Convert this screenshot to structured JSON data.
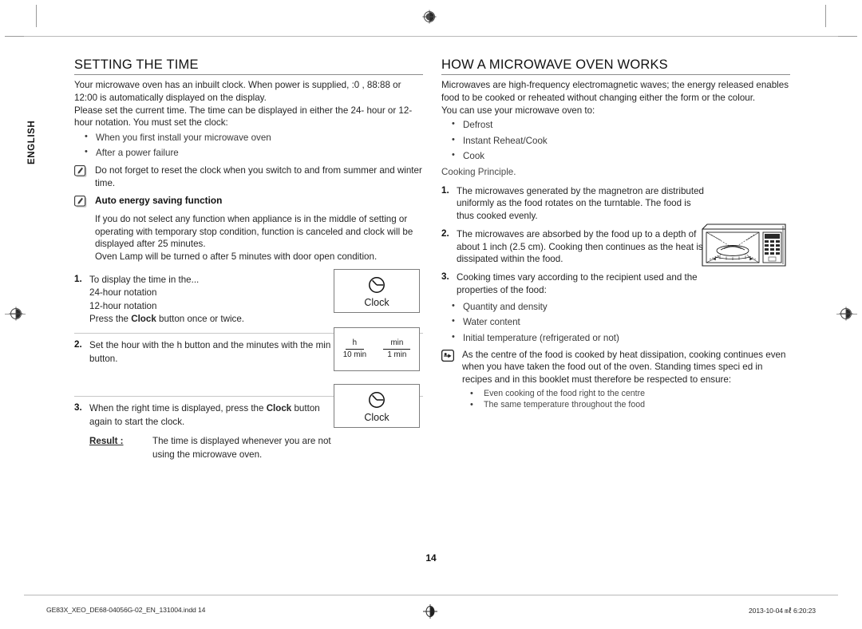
{
  "sidebar": {
    "language_tab": "ENGLISH"
  },
  "left_column": {
    "title": "SETTING THE TIME",
    "intro_p1": "Your microwave oven has an inbuilt clock. When power is supplied,  :0 ,  88:88 or  12:00  is automatically displayed on the display.",
    "intro_p2": "Please set the current time. The time can be displayed in either the 24- hour or 12-hour notation. You must set the clock:",
    "bullets": [
      "When you first install your microwave oven",
      "After a power failure"
    ],
    "note_1": {
      "icon": "note-pencil-icon",
      "text": "Do not forget to reset the clock when you switch to and from summer and winter time."
    },
    "note_2": {
      "icon": "note-pencil-icon",
      "heading": "Auto energy saving function",
      "text_line_1": "If you do not select any function when appliance is in the middle of setting or operating with temporary stop condition, function is canceled and clock will be displayed after 25 minutes.",
      "text_line_2": "Oven Lamp will be turned o  after 5 minutes with door open condition."
    },
    "steps": [
      {
        "number": "1.",
        "text": "To display the time in the...",
        "sub_lines": [
          "24-hour notation",
          "12-hour notation"
        ],
        "action_prefix": "Press the ",
        "action_bold": "Clock",
        "action_suffix": " button once or twice."
      },
      {
        "number": "2.",
        "text": "Set the hour with the h button and the minutes with the min button."
      },
      {
        "number": "3.",
        "text_prefix": "When the right time is displayed, press the ",
        "text_bold": "Clock",
        "text_suffix": " button again to start the clock.",
        "result_label": "Result :",
        "result_text": "The time is displayed whenever you are not using the microwave oven."
      }
    ],
    "key_boxes": {
      "clock_1": {
        "icon": "clock-icon",
        "label": "Clock"
      },
      "hmin": {
        "left": {
          "numerator": "h",
          "denominator": "10 min"
        },
        "right": {
          "numerator": "min",
          "denominator": "1 min"
        }
      },
      "clock_2": {
        "icon": "clock-icon",
        "label": "Clock"
      }
    }
  },
  "right_column": {
    "title": "HOW A MICROWAVE OVEN WORKS",
    "intro_p1": "Microwaves are high-frequency electromagnetic waves; the energy released enables food to be cooked or reheated without changing either the form or the colour.",
    "intro_p2": "You can use your microwave oven to:",
    "uses": [
      "Defrost",
      "Instant Reheat/Cook",
      "Cook"
    ],
    "cooking_principle": "Cooking Principle.",
    "steps": [
      {
        "number": "1.",
        "text": "The microwaves generated by the magnetron are distributed uniformly as the food rotates on the turntable. The food is thus cooked evenly."
      },
      {
        "number": "2.",
        "text": "The microwaves are absorbed by the food up to a depth of about 1 inch (2.5 cm). Cooking then continues as the heat is dissipated within the food."
      },
      {
        "number": "3.",
        "text": "Cooking times vary according to the recipient used and the properties of the food:"
      }
    ],
    "food_properties": [
      "Quantity and density",
      "Water content",
      "Initial temperature (refrigerated or not)"
    ],
    "note": {
      "icon": "pointing-hand-icon",
      "text": "As the centre of the food is cooked by heat dissipation, cooking continues even when you have taken the food out of the oven. Standing times speci ed in recipes and in this booklet must therefore be respected to ensure:"
    },
    "note_bullets": [
      "Even cooking of the food right to the centre",
      "The same temperature throughout the food"
    ],
    "illustration": "microwave-oven-illustration"
  },
  "page_number": "14",
  "footer": {
    "file_name": "GE83X_XEO_DE68-04056G-02_EN_131004.indd   14",
    "timestamp": "2013-10-04   ㎖ 6:20:23",
    "registration_mark": "registration-target-icon"
  },
  "colors": {
    "text": "#262626",
    "heading": "#111111",
    "rule": "#8c8c8c",
    "crop_mark": "#9a9a9a"
  }
}
